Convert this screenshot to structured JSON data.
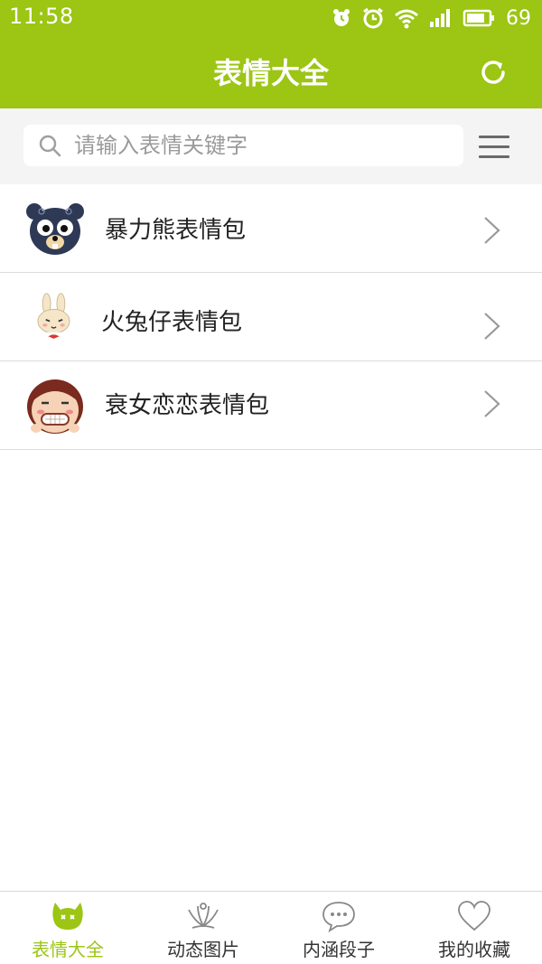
{
  "status_bar": {
    "time": "11:58",
    "battery": "69",
    "icons": [
      "alarm-app-icon",
      "alarm-clock-icon",
      "wifi-icon",
      "signal-icon",
      "battery-icon"
    ]
  },
  "header": {
    "title": "表情大全",
    "refresh_icon": "refresh-icon"
  },
  "search": {
    "placeholder": "请输入表情关键字",
    "value": ""
  },
  "list": {
    "items": [
      {
        "label": "暴力熊表情包",
        "icon": "bear-avatar-icon"
      },
      {
        "label": "火兔仔表情包",
        "icon": "rabbit-avatar-icon"
      },
      {
        "label": "衰女恋恋表情包",
        "icon": "girl-avatar-icon"
      }
    ]
  },
  "bottom_nav": {
    "items": [
      {
        "label": "表情大全",
        "icon": "emoji-face-icon",
        "active": true
      },
      {
        "label": "动态图片",
        "icon": "animated-image-icon",
        "active": false
      },
      {
        "label": "内涵段子",
        "icon": "chat-bubble-icon",
        "active": false
      },
      {
        "label": "我的收藏",
        "icon": "heart-icon",
        "active": false
      }
    ]
  },
  "colors": {
    "primary": "#9cc514",
    "search_bg": "#f4f4f4",
    "divider": "#dcdcdc",
    "text": "#222222",
    "placeholder": "#9a9a9a"
  }
}
